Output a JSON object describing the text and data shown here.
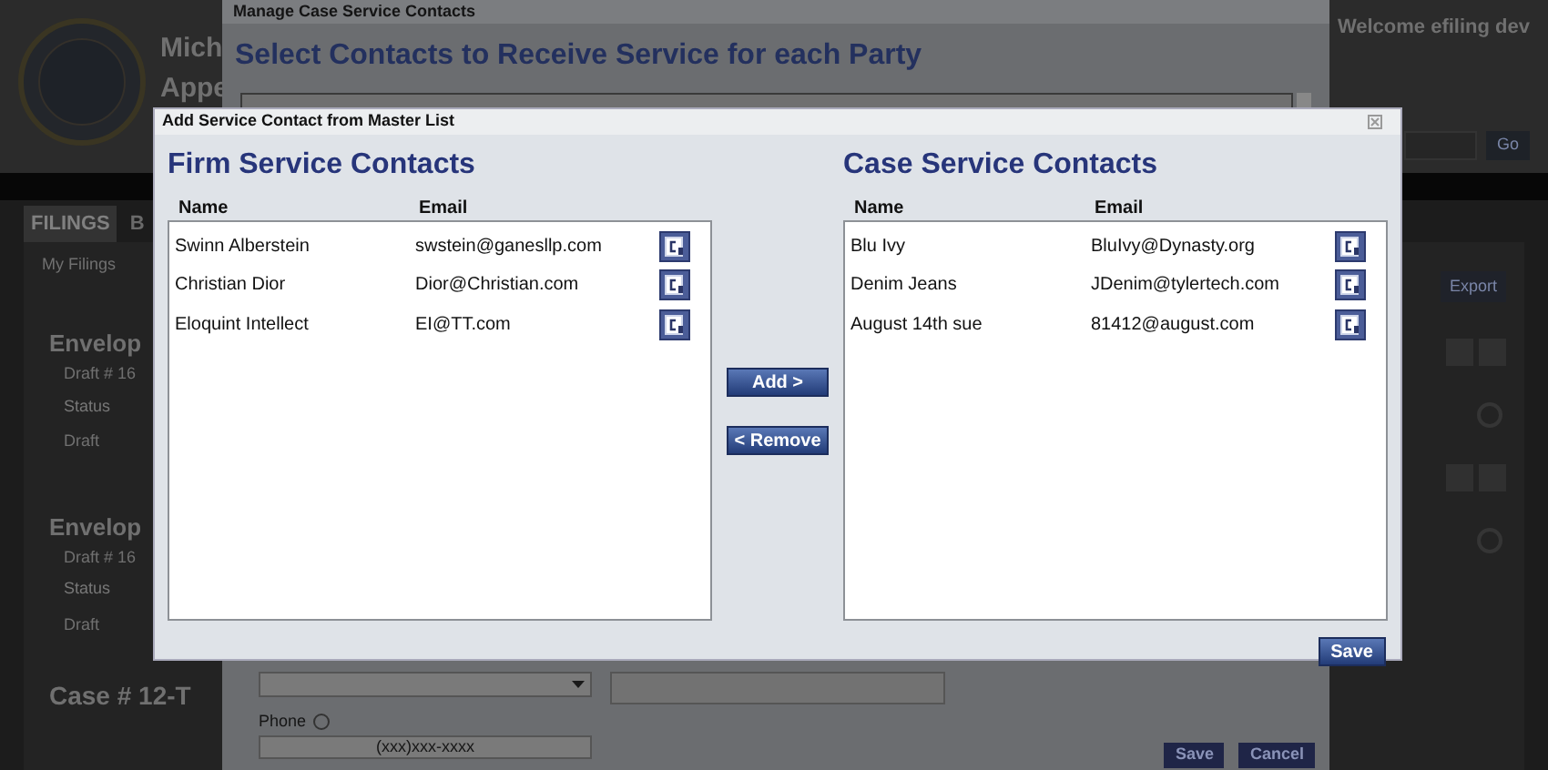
{
  "page": {
    "title_lines": [
      "Mich",
      "Appe"
    ],
    "welcome": "Welcome efiling dev",
    "go_button": "Go",
    "tabs": [
      {
        "label": "FILINGS",
        "selected": true
      },
      {
        "label": "B",
        "selected": false
      }
    ],
    "subtab": "My Filings",
    "envelopes": [
      {
        "title": "Envelop",
        "draft": "Draft # 16",
        "status_label": "Status",
        "status": "Draft"
      },
      {
        "title": "Envelop",
        "draft": "Draft # 16",
        "status_label": "Status",
        "status": "Draft"
      }
    ],
    "case_title": "Case # 12-T",
    "export_button": "Export"
  },
  "manage_dialog": {
    "title": "Manage Case Service Contacts",
    "heading": "Select Contacts to Receive Service for each Party",
    "phone_label": "Phone",
    "phone_placeholder": "(xxx)xxx-xxxx",
    "buttons": [
      "Save",
      "Cancel"
    ]
  },
  "add_dialog": {
    "title": "Add Service Contact from Master List",
    "panels": [
      {
        "heading": "Firm Service Contacts",
        "columns": [
          "Name",
          "Email"
        ],
        "rows": [
          {
            "name": "Swinn Alberstein",
            "email": "swstein@ganesllp.com"
          },
          {
            "name": "Christian Dior",
            "email": "Dior@Christian.com"
          },
          {
            "name": "Eloquint Intellect",
            "email": "EI@TT.com"
          }
        ]
      },
      {
        "heading": "Case Service Contacts",
        "columns": [
          "Name",
          "Email"
        ],
        "rows": [
          {
            "name": "Blu Ivy",
            "email": "BluIvy@Dynasty.org"
          },
          {
            "name": "Denim Jeans",
            "email": "JDenim@tylertech.com"
          },
          {
            "name": "August 14th sue",
            "email": "81412@august.com"
          }
        ]
      }
    ],
    "add_button": "Add >",
    "remove_button": "< Remove",
    "save_button": "Save"
  }
}
